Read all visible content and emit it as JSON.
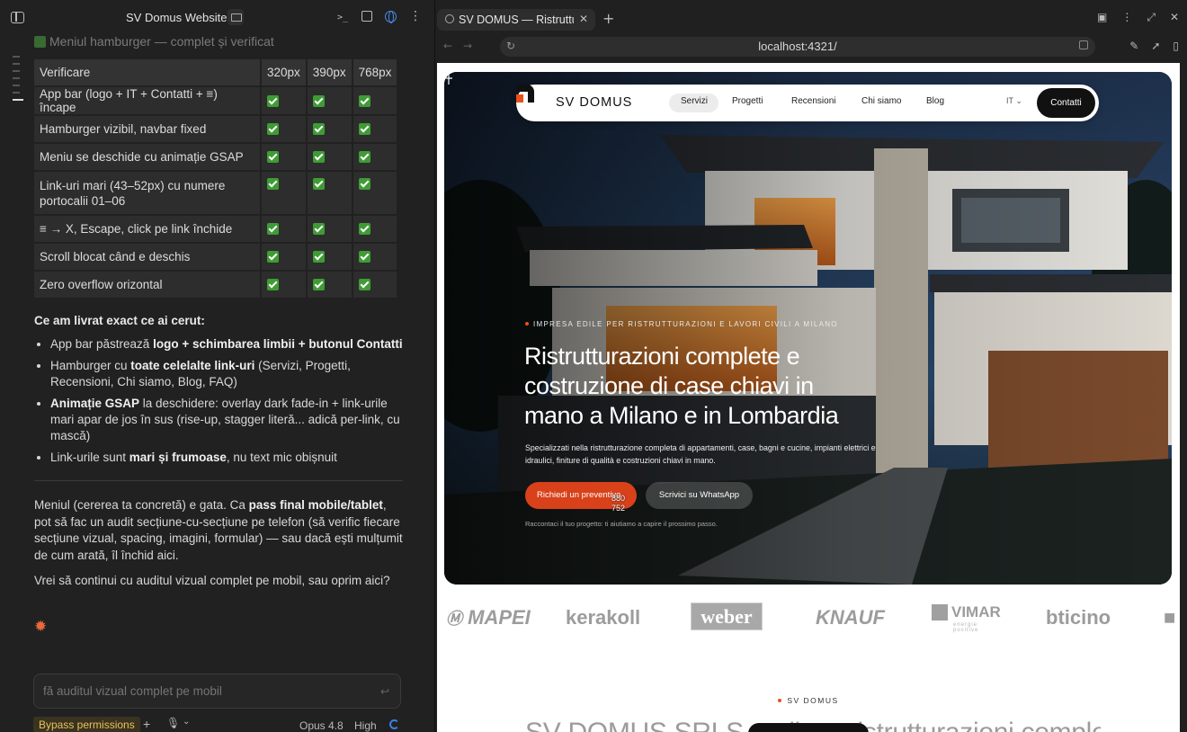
{
  "left_pane": {
    "title": "SV Domus Website",
    "faded_heading": "Meniul hamburger — complet și verificat",
    "table": {
      "headers": [
        "Verificare",
        "320px",
        "390px",
        "768px"
      ],
      "rows": [
        "App bar (logo + IT + Contatti + ≡) încape",
        "Hamburger vizibil, navbar fixed",
        "Meniu se deschide cu animație GSAP",
        "Link-uri mari (43–52px) cu numere portocalii 01–06",
        "≡ → X, Escape, click pe link închide",
        "Scroll blocat când e deschis",
        "Zero overflow orizontal"
      ]
    },
    "delivered_heading": "Ce am livrat exact ce ai cerut:",
    "bullets": [
      {
        "pre": "App bar păstrează ",
        "bold": "logo + schimbarea limbii + butonul Contatti",
        "post": ""
      },
      {
        "pre": "Hamburger cu ",
        "bold": "toate celelalte link-uri",
        "post": " (Servizi, Progetti, Recensioni, Chi siamo, Blog, FAQ)"
      },
      {
        "pre": "",
        "bold": "Animație GSAP",
        "post": " la deschidere: overlay dark fade-in + link-urile mari apar de jos în sus (rise-up, stagger literă... adică per-link, cu mască)"
      },
      {
        "pre": "Link-urile sunt ",
        "bold": "mari și frumoase",
        "post": ", nu text mic obișnuit"
      }
    ],
    "para1": {
      "pre": "Meniul (cererea ta concretă) e gata. Ca ",
      "bold": "pass final mobile/tablet",
      "post": ", pot să fac un audit secțiune-cu-secțiune pe telefon (să verific fiecare secțiune vizual, spacing, imagini, formular) — sau dacă ești mulțumit de cum arată, îl închid aici."
    },
    "para2": "Vrei să continui cu auditul vizual complet pe mobil, sau oprim aici?",
    "input_placeholder": "fă auditul vizual complet pe mobil",
    "bypass_label": "Bypass permissions",
    "model": "Opus 4.8",
    "effort": "High"
  },
  "browser": {
    "tab_title": "SV DOMUS — Ristrutturazioni",
    "url": "localhost:4321/",
    "site": {
      "logo": "SV DOMUS",
      "nav_links": [
        "Servizi",
        "Progetti",
        "Recensioni",
        "Chi siamo",
        "Blog"
      ],
      "active_link": "Servizi",
      "lang": "IT",
      "contact_button": "Contatti",
      "eyebrow": "IMPRESA EDILE PER RISTRUTTURAZIONI E LAVORI CIVILI A MILANO",
      "hero_title": "Ristrutturazioni complete e costruzione di case chiavi in mano a Milano e in Lombardia",
      "hero_subtitle": "Specializzati nella ristrutturazione completa di appartamenti, case, bagni e cucine, impianti elettrici e idraulici, finiture di qualità e costruzioni chiavi in mano.",
      "primary_button": "Richiedi un preventivo",
      "secondary_button": "Scrivici su WhatsApp",
      "hero_note": "Raccontaci il tuo progetto: ti aiutiamo a capire il prossimo passo.",
      "cursor_readout": [
        "880",
        "752"
      ],
      "brands": [
        "MAPEI",
        "kerakoll",
        "weber",
        "KNAUF",
        "VIMAR",
        "energie positive",
        "bticino"
      ],
      "section_label": "SV DOMUS",
      "section_heading": "SV DOMUS SRLS realizza ristrutturazioni complete"
    }
  },
  "colors": {
    "accent": "#d8411a",
    "check": "#3f9c35",
    "spinner": "#3d7fe0"
  }
}
